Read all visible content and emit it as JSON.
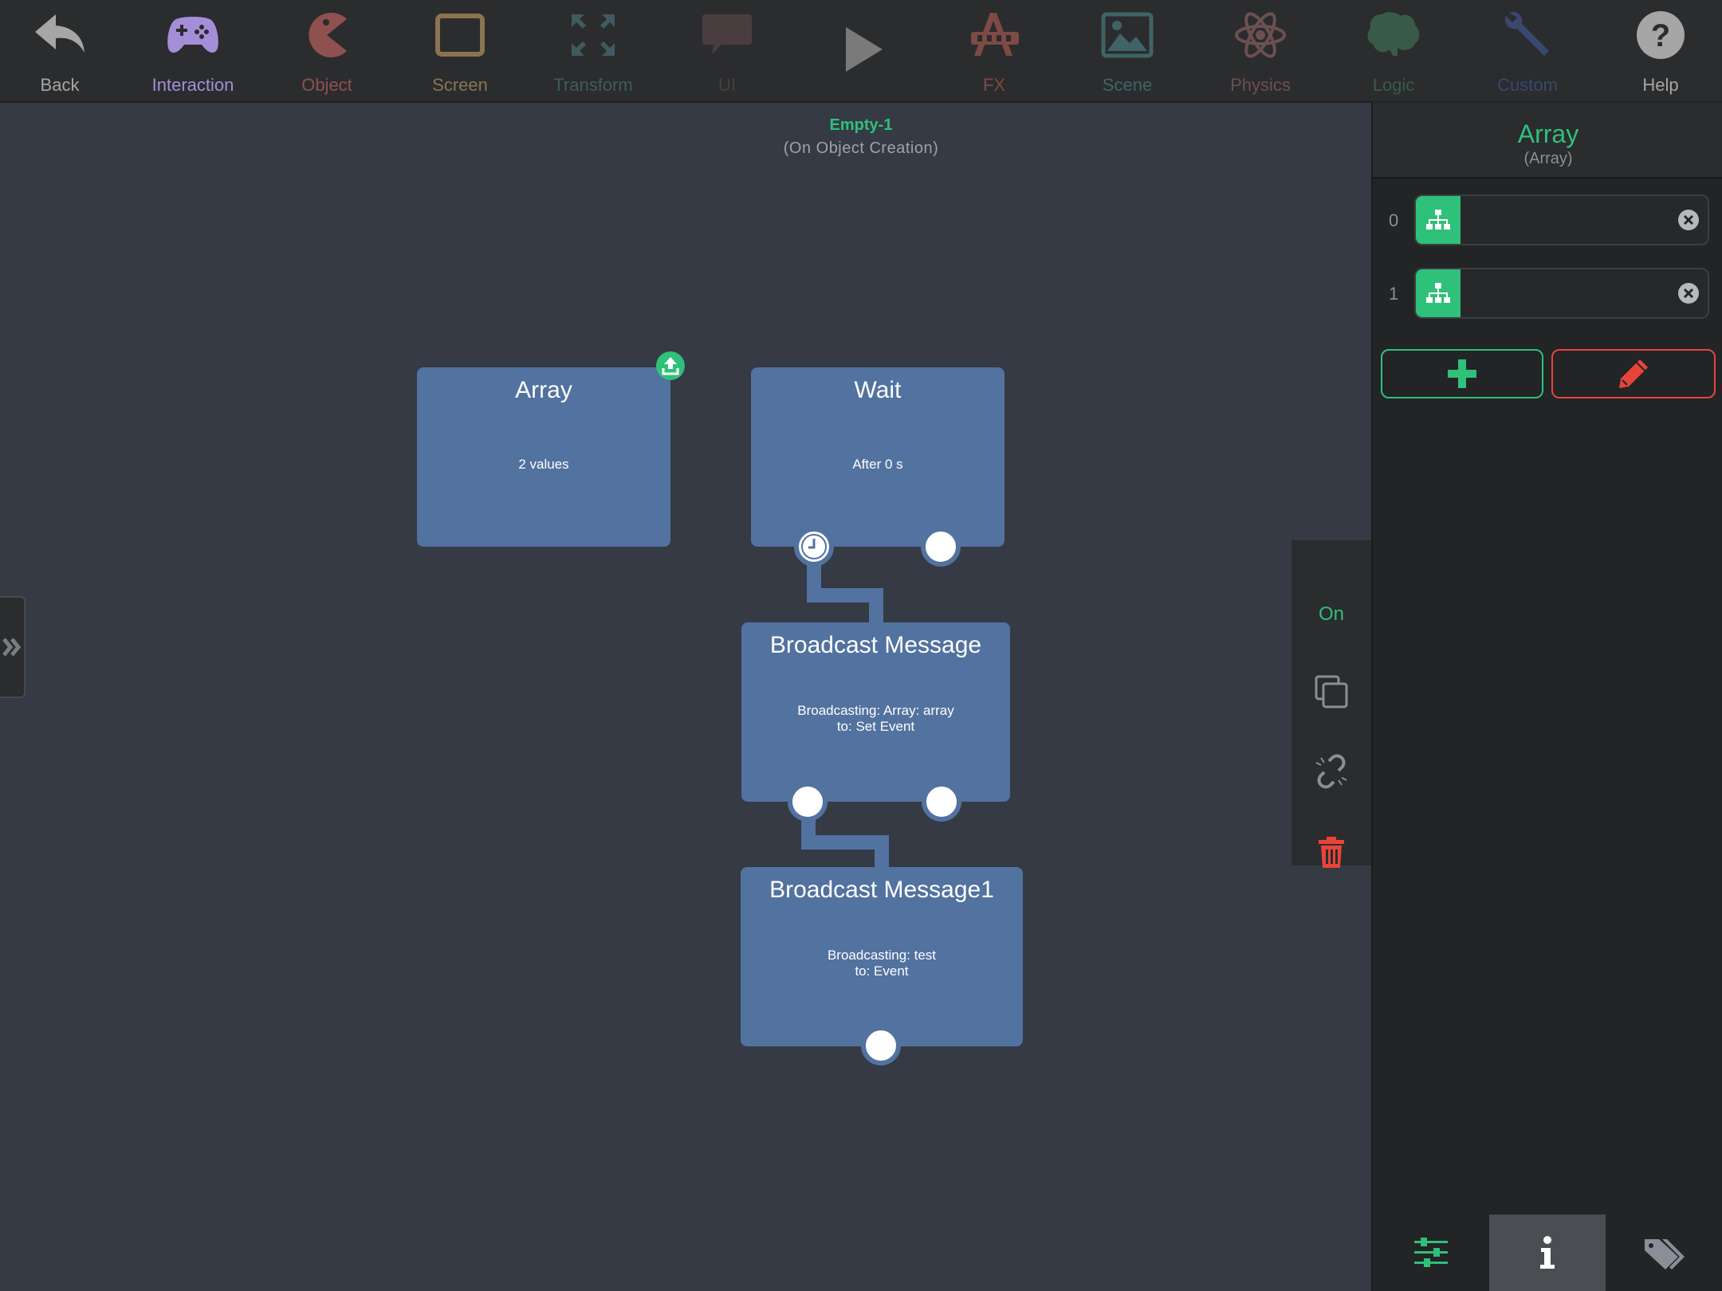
{
  "toolbar": {
    "items": [
      {
        "label": "Back",
        "icon": "back-arrow-icon",
        "color": "#a6a6a6"
      },
      {
        "label": "Interaction",
        "icon": "gamepad-icon",
        "color": "#a58ed8"
      },
      {
        "label": "Object",
        "icon": "pacman-icon",
        "color": "#8e5150"
      },
      {
        "label": "Screen",
        "icon": "tablet-icon",
        "color": "#8a7450"
      },
      {
        "label": "Transform",
        "icon": "expand-arrows-icon",
        "color": "#3f5b5f"
      },
      {
        "label": "UI",
        "icon": "speech-bubble-icon",
        "color": "#4a3d40"
      },
      {
        "label": "",
        "icon": "play-icon",
        "color": "#7a7a7a"
      },
      {
        "label": "FX",
        "icon": "fx-icon",
        "color": "#7e4a44"
      },
      {
        "label": "Scene",
        "icon": "image-icon",
        "color": "#3f6466"
      },
      {
        "label": "Physics",
        "icon": "atom-icon",
        "color": "#6c5050"
      },
      {
        "label": "Logic",
        "icon": "brain-icon",
        "color": "#3a5a48"
      },
      {
        "label": "Custom",
        "icon": "wrench-icon",
        "color": "#3a4770"
      },
      {
        "label": "Help",
        "icon": "help-icon",
        "color": "#a6a6a6"
      }
    ]
  },
  "canvas": {
    "title": "Empty-1",
    "subtitle": "(On Object Creation)"
  },
  "nodes": {
    "array": {
      "title": "Array",
      "desc": "2 values"
    },
    "wait": {
      "title": "Wait",
      "desc": "After 0 s"
    },
    "broadcast": {
      "title": "Broadcast Message",
      "desc": "Broadcasting: Array: array\nto: Set Event"
    },
    "broadcast1": {
      "title": "Broadcast Message1",
      "desc": "Broadcasting: test\nto: Event"
    }
  },
  "float_bar": {
    "toggle_label": "On",
    "accent": "#2fc07a",
    "danger": "#e8443a"
  },
  "panel": {
    "title": "Array",
    "subtitle": "(Array)",
    "rows": [
      {
        "index": "0",
        "value": ""
      },
      {
        "index": "1",
        "value": ""
      }
    ],
    "add_icon": "plus-icon",
    "edit_icon": "pencil-icon",
    "tabs": [
      {
        "icon": "sliders-icon",
        "active": false
      },
      {
        "icon": "info-icon",
        "active": true
      },
      {
        "icon": "tags-icon",
        "active": false
      }
    ]
  }
}
